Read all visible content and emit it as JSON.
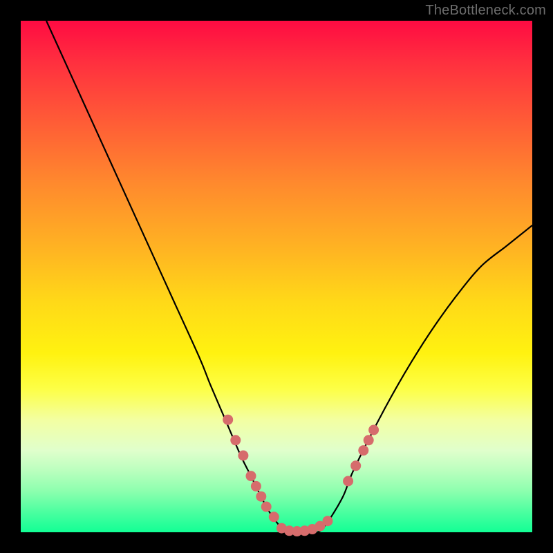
{
  "watermark": "TheBottleneck.com",
  "chart_data": {
    "type": "line",
    "title": "",
    "xlabel": "",
    "ylabel": "",
    "xlim": [
      0,
      100
    ],
    "ylim": [
      0,
      100
    ],
    "series": [
      {
        "name": "bottleneck-curve",
        "x": [
          5,
          10,
          15,
          20,
          25,
          30,
          35,
          37,
          40,
          43,
          45,
          48,
          50,
          52,
          55,
          58,
          60,
          63,
          65,
          70,
          75,
          80,
          85,
          90,
          95,
          100
        ],
        "values": [
          100,
          89,
          78,
          67,
          56,
          45,
          34,
          29,
          22,
          15,
          11,
          5,
          2,
          0,
          0,
          0,
          2,
          7,
          12,
          22,
          31,
          39,
          46,
          52,
          56,
          60
        ]
      }
    ],
    "marker_clusters": [
      {
        "name": "left-slope-markers",
        "x": [
          40.5,
          42.0,
          43.5,
          45.0,
          46.0,
          47.0,
          48.0,
          49.5
        ],
        "values": [
          22,
          18,
          15,
          11,
          9,
          7,
          5,
          3
        ]
      },
      {
        "name": "valley-floor-markers",
        "x": [
          51.0,
          52.5,
          54.0,
          55.5,
          57.0,
          58.5,
          60.0
        ],
        "values": [
          0.8,
          0.3,
          0.2,
          0.3,
          0.6,
          1.2,
          2.2
        ]
      },
      {
        "name": "right-slope-markers",
        "x": [
          64.0,
          65.5,
          67.0,
          68.0,
          69.0
        ],
        "values": [
          10,
          13,
          16,
          18,
          20
        ]
      }
    ],
    "marker_color": "#d66c6c",
    "curve_color": "#000000"
  }
}
